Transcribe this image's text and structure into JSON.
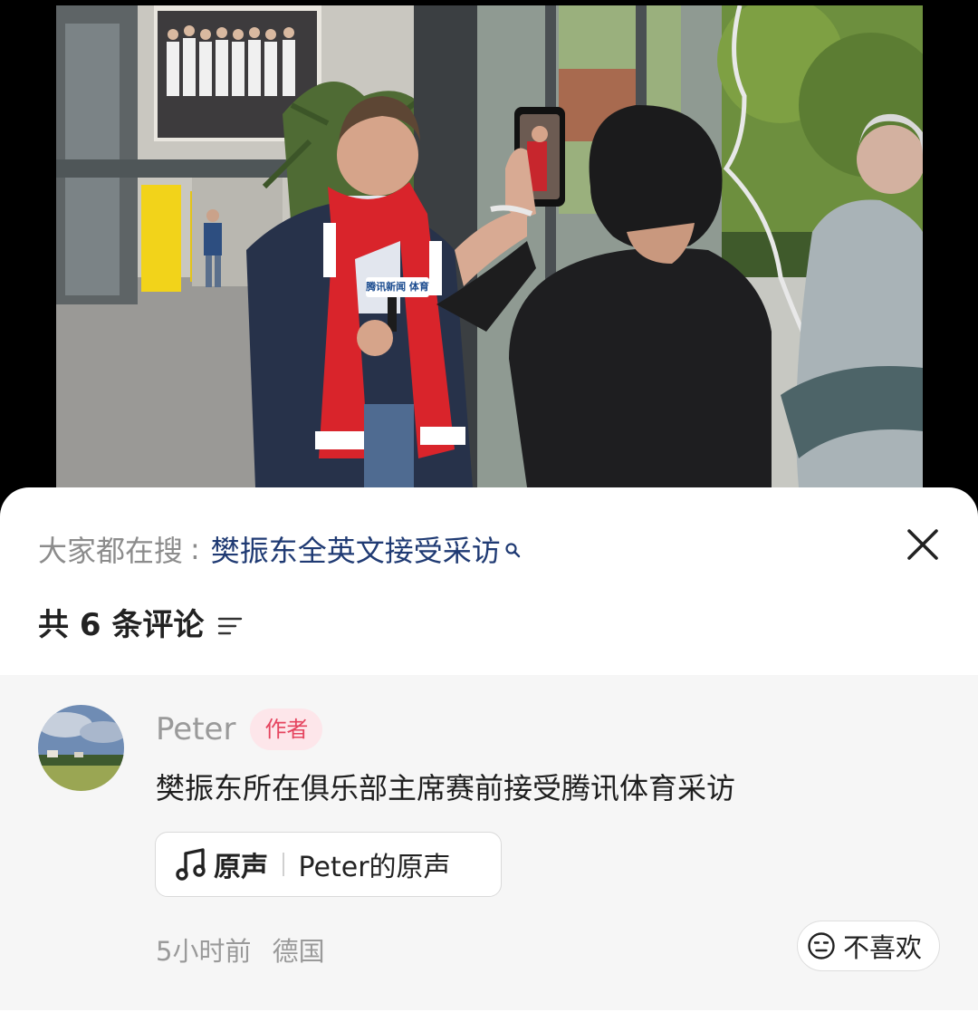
{
  "video": {
    "mic_label": "腾讯新闻 体育"
  },
  "search": {
    "prefix": "大家都在搜",
    "separator": ":",
    "query": "樊振东全英文接受采访"
  },
  "comments_header": {
    "count_text": "共 6 条评论"
  },
  "comment": {
    "author": "Peter",
    "badge": "作者",
    "text": "樊振东所在俱乐部主席赛前接受腾讯体育采访",
    "sound": {
      "label": "原声",
      "name": "Peter的原声"
    },
    "time": "5小时前",
    "location": "德国",
    "dislike_label": "不喜欢"
  },
  "icons": {
    "close": "close-icon",
    "search": "search-icon",
    "sort": "sort-icon",
    "music": "music-note-icon",
    "dislike": "neutral-face-icon"
  },
  "colors": {
    "search_link": "#1f3a73",
    "badge_text": "#e5455f",
    "badge_bg": "#fde6ea",
    "comment_bg": "#f6f6f6"
  }
}
